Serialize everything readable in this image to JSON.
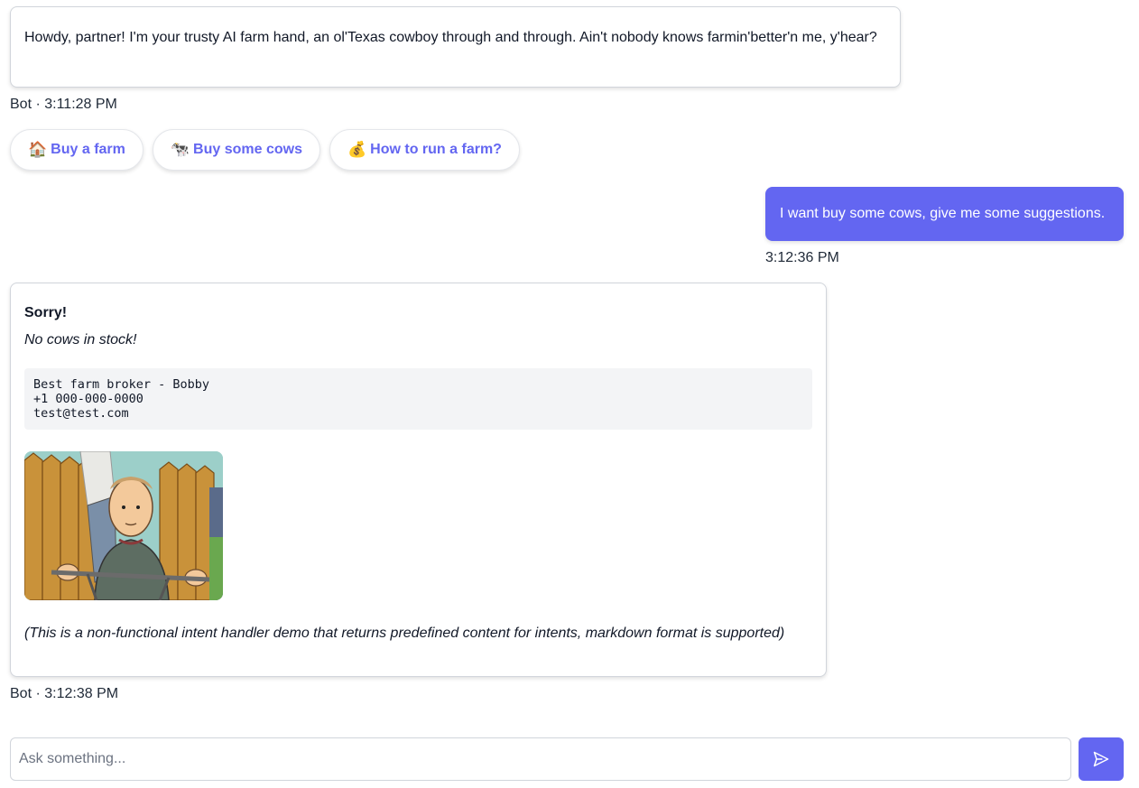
{
  "messages": [
    {
      "sender": "Bot",
      "time": "3:11:28 PM",
      "text": "Howdy, partner! I'm your trusty AI farm hand, an ol'Texas cowboy through and through. Ain't nobody knows farmin'better'n me, y'hear?",
      "meta": "Bot · 3:11:28 PM"
    },
    {
      "sender": "User",
      "time": "3:12:36 PM",
      "text": "I want buy some cows, give me some suggestions.",
      "meta": "3:12:36 PM"
    },
    {
      "sender": "Bot",
      "time": "3:12:38 PM",
      "meta": "Bot · 3:12:38 PM",
      "title": "Sorry!",
      "subtitle": "No cows in stock!",
      "code": "Best farm broker - Bobby\n+1 000-000-0000\ntest@test.com",
      "note": "(This is a non-functional intent handler demo that returns predefined content for intents, markdown format is supported)"
    }
  ],
  "chips": [
    {
      "emoji": "🏠",
      "label": "Buy a farm"
    },
    {
      "emoji": "🐄",
      "label": "Buy some cows"
    },
    {
      "emoji": "💰",
      "label": "How to run a farm?"
    }
  ],
  "composer": {
    "placeholder": "Ask something...",
    "value": ""
  },
  "icons": {
    "send": "send-icon"
  },
  "colors": {
    "accent": "#6366f1"
  }
}
